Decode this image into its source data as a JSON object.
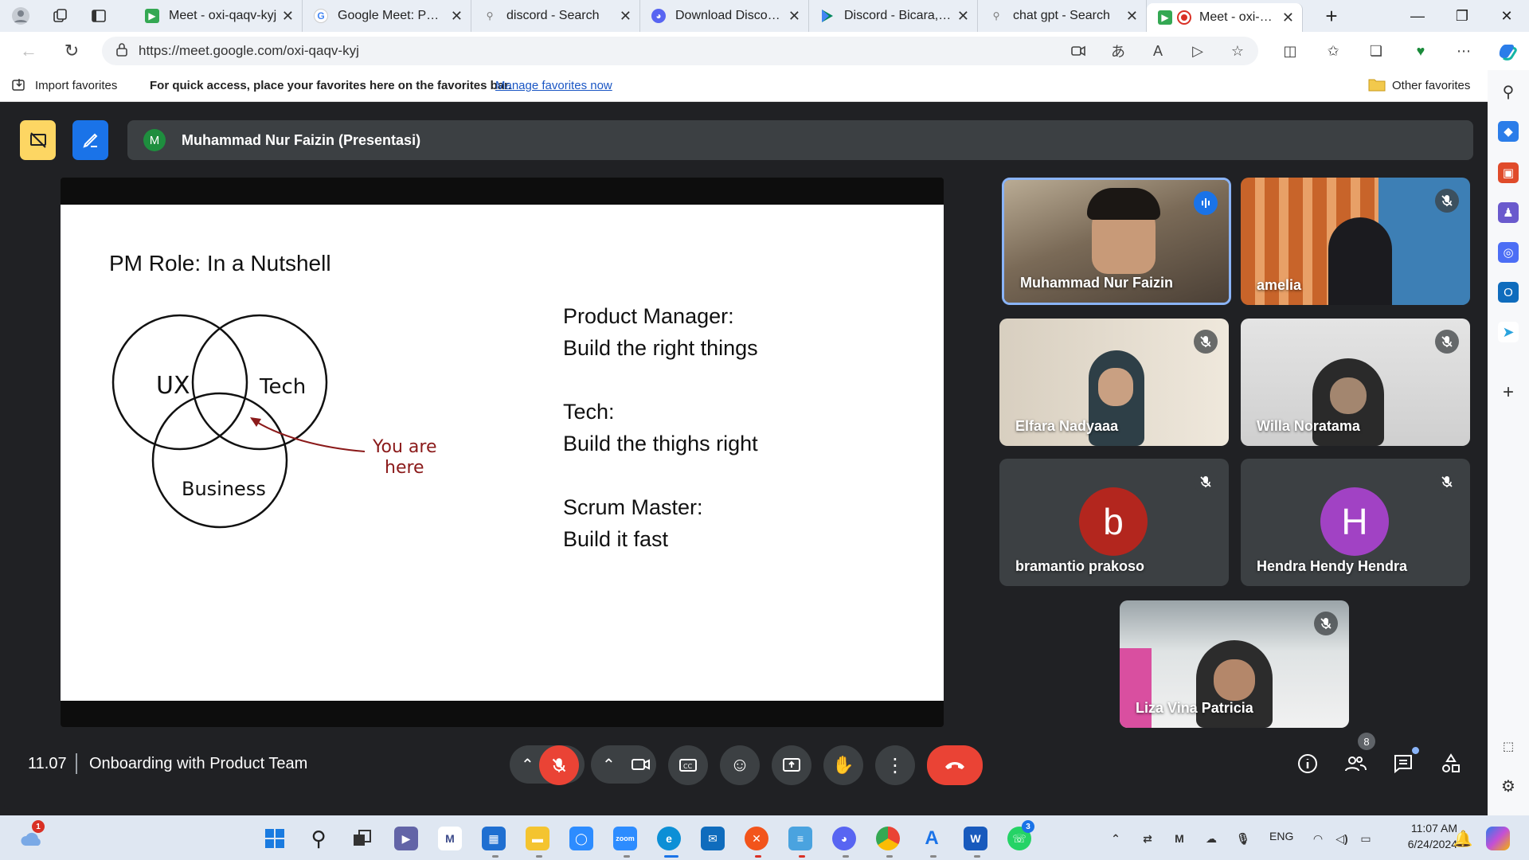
{
  "browser": {
    "tabs": [
      {
        "label": "Meet - oxi-qaqv-kyj",
        "icon": "google-meet-icon",
        "color": "#34a853"
      },
      {
        "label": "Google Meet: Pangg",
        "icon": "google-icon",
        "color": "#4285f4"
      },
      {
        "label": "discord - Search",
        "icon": "search-icon",
        "color": "#8a8a8a"
      },
      {
        "label": "Download Discord t",
        "icon": "discord-icon",
        "color": "#5865f2"
      },
      {
        "label": "Discord - Bicara, Ma",
        "icon": "play-store-icon",
        "color": "#01875f"
      },
      {
        "label": "chat gpt - Search",
        "icon": "search-icon",
        "color": "#8a8a8a"
      },
      {
        "label": "Meet - oxi-qaq",
        "icon": "google-meet-icon",
        "color": "#34a853",
        "active": true
      }
    ],
    "url": "https://meet.google.com/oxi-qaqv-kyj",
    "favbar": {
      "import": "Import favorites",
      "message": "For quick access, place your favorites here on the favorites bar.",
      "manage_link": "Manage favorites now",
      "other": "Other favorites"
    }
  },
  "meet": {
    "presenter_label": "Muhammad Nur Faizin (Presentasi)",
    "presenter_initial": "M",
    "time": "11.07",
    "meeting_name": "Onboarding with Product Team",
    "participant_count": "8",
    "slide": {
      "title": "PM Role: In a Nutshell",
      "venn": {
        "ux": "UX",
        "tech": "Tech",
        "business": "Business",
        "note_line1": "You are",
        "note_line2": "here"
      },
      "lines": [
        "Product Manager:",
        "Build the right things",
        "Tech:",
        "Build the thighs right",
        "Scrum Master:",
        "Build it fast"
      ]
    },
    "participants": [
      {
        "name": "Muhammad Nur Faizin",
        "speaking": true
      },
      {
        "name": "amelia"
      },
      {
        "name": "Elfara Nadyaaa"
      },
      {
        "name": "Willa Noratama"
      },
      {
        "name": "bramantio prakoso",
        "initial": "b",
        "color": "#b3261e"
      },
      {
        "name": "Hendra Hendy Hendra",
        "initial": "H",
        "color": "#a142c4"
      },
      {
        "name": "Liza Vina Patricia"
      }
    ]
  },
  "taskbar": {
    "language": "ENG",
    "clock_time": "11:07 AM",
    "clock_date": "6/24/2024",
    "weather_badge": "1",
    "whatsapp_badge": "3"
  }
}
